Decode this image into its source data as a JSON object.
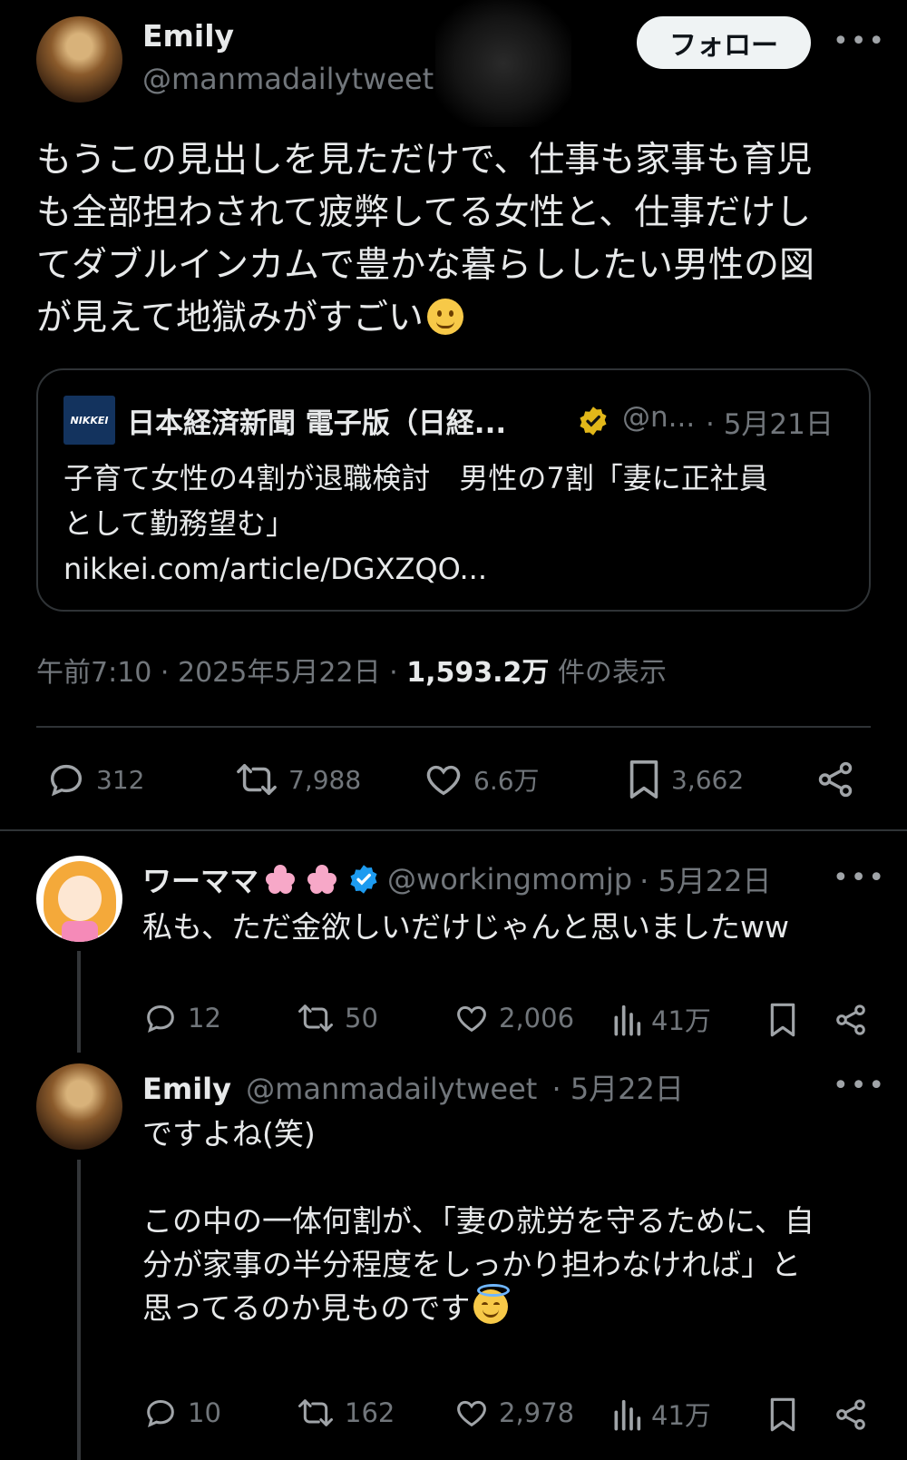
{
  "main_tweet": {
    "author_name": "Emily",
    "author_handle": "@manmadailytweet",
    "follow_label": "フォロー",
    "more_label": "•••",
    "text_lines": [
      "もうこの見出しを見ただけで、仕事も家事も育児",
      "も全部担わされて疲弊してる女性と、仕事だけし",
      "てダブルインカムで豊かな暮らししたい男性の図",
      "が見えて地獄みがすごい"
    ],
    "quote": {
      "logo_text": "NIKKEI",
      "source_name": "日本経済新聞 電子版（日経...",
      "source_handle": "@n...",
      "date": "· 5月21日",
      "headline_lines": [
        "子育て女性の4割が退職検討　男性の7割「妻に正社員",
        "として勤務望む」"
      ],
      "link": "nikkei.com/article/DGXZQO..."
    },
    "meta": {
      "time_date": "午前7:10 · 2025年5月22日 · ",
      "views_count": "1,593.2万",
      "views_label": " 件の表示"
    },
    "actions": {
      "replies": "312",
      "retweets": "7,988",
      "likes": "6.6万",
      "bookmarks": "3,662"
    }
  },
  "replies": [
    {
      "author_name": "ワーママ",
      "author_handle": "@workingmomjp",
      "date": "· 5月22日",
      "text_lines": [
        "私も、ただ金欲しいだけじゃんと思いましたww"
      ],
      "actions": {
        "replies": "12",
        "retweets": "50",
        "likes": "2,006",
        "views": "41万"
      }
    },
    {
      "author_name": "Emily",
      "author_handle": "@manmadailytweet",
      "date": "· 5月22日",
      "text_lines": [
        "ですよね(笑)",
        "",
        "この中の一体何割が、「妻の就労を守るために、自",
        "分が家事の半分程度をしっかり担わなければ」と",
        "思ってるのか見ものです"
      ],
      "actions": {
        "replies": "10",
        "retweets": "162",
        "likes": "2,978",
        "views": "41万"
      }
    }
  ],
  "colors": {
    "background": "#000000",
    "text": "#e7e9ea",
    "muted": "#71767b",
    "border": "#2f3336",
    "verified_blue": "#1d9bf0",
    "verified_gold": "#e2b719"
  },
  "icons": [
    "reply-icon",
    "retweet-icon",
    "like-icon",
    "bookmark-icon",
    "share-icon",
    "views-icon",
    "verified-badge-icon",
    "more-icon"
  ]
}
